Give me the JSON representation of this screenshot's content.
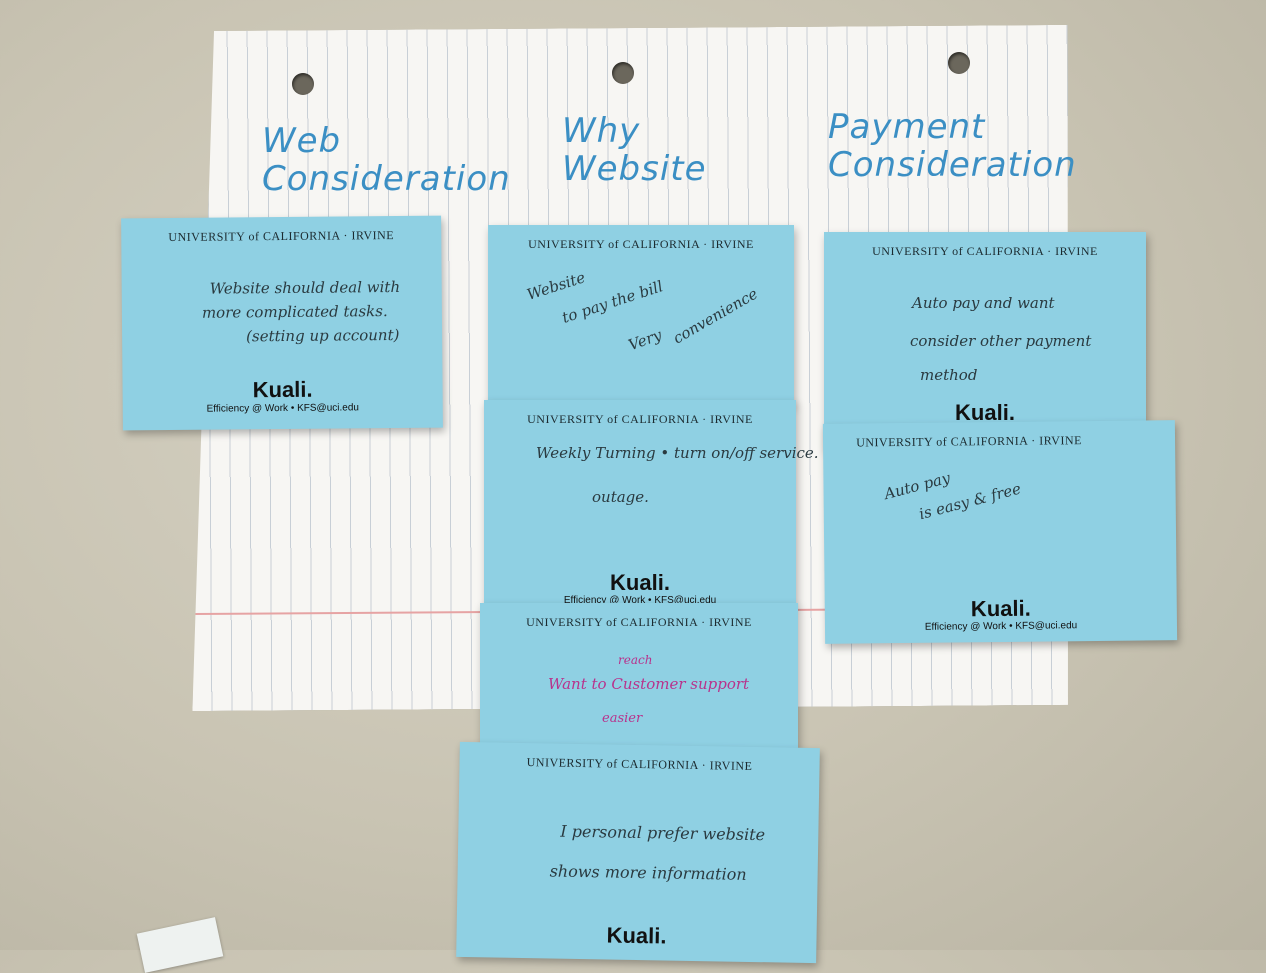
{
  "headings": [
    "Web\nConsideration",
    "Why\nWebsite",
    "Payment\nConsideration"
  ],
  "note_header": "UNIVERSITY of CALIFORNIA · IRVINE",
  "brand": "Kuali.",
  "footer": "Efficiency @ Work  •  KFS@uci.edu",
  "notes": [
    {
      "lines": [
        "Website should deal with",
        "more complicated tasks.",
        "(setting up account)"
      ]
    },
    {
      "lines": [
        "Website",
        "to pay the bill",
        "convenience",
        "Very"
      ]
    },
    {
      "lines": [
        "Weekly Turning • turn on/off service.",
        "outage."
      ]
    },
    {
      "lines": [
        "reach",
        "Want to Customer support",
        "easier"
      ]
    },
    {
      "lines": [
        "I personal prefer website",
        "shows more information"
      ]
    },
    {
      "lines": [
        "Auto pay and want",
        "consider other payment",
        "method"
      ]
    },
    {
      "lines": [
        "Auto pay",
        "is easy & free"
      ]
    }
  ]
}
